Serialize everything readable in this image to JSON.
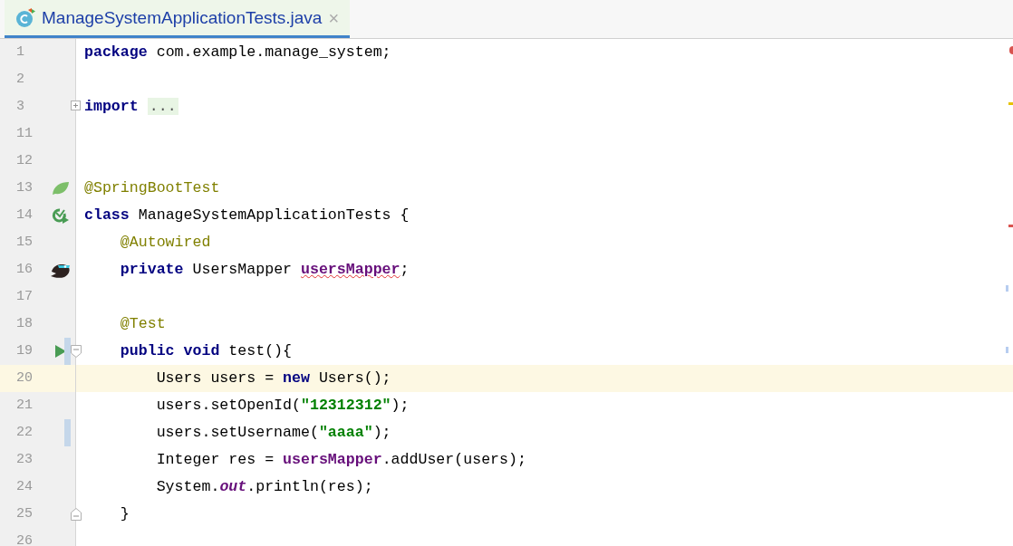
{
  "tab": {
    "title": "ManageSystemApplicationTests.java",
    "close": "×",
    "selected": true
  },
  "lines": [
    {
      "number": "1",
      "tokens": [
        {
          "kind": "keyword",
          "text": "package"
        },
        {
          "kind": "plain",
          "text": " com.example.manage_system;"
        }
      ]
    },
    {
      "number": "2"
    },
    {
      "number": "3",
      "fold": {
        "kind": "collapsed"
      },
      "tokens": [
        {
          "kind": "keyword",
          "text": "import "
        },
        {
          "kind": "folded",
          "text": "..."
        }
      ]
    },
    {
      "number": "11"
    },
    {
      "number": "12"
    },
    {
      "number": "13",
      "kind": "leaf",
      "tokens": [
        {
          "kind": "annotation",
          "text": "@SpringBootTest"
        }
      ]
    },
    {
      "number": "14",
      "kind": "run-class",
      "tokens": [
        {
          "kind": "keyword",
          "text": "class"
        },
        {
          "kind": "plain",
          "text": " ManageSystemApplicationTests {"
        }
      ]
    },
    {
      "number": "15",
      "tokens": [
        {
          "kind": "annotation",
          "text": "    @Autowired"
        }
      ]
    },
    {
      "number": "16",
      "kind": "bird",
      "tokens": [
        {
          "kind": "keyword",
          "text": "    private"
        },
        {
          "kind": "plain",
          "text": " UsersMapper "
        },
        {
          "kind": "field",
          "text": "usersMapper",
          "typo": true
        },
        {
          "kind": "plain",
          "text": ";"
        }
      ]
    },
    {
      "number": "17"
    },
    {
      "number": "18",
      "tokens": [
        {
          "kind": "annotation",
          "text": "    @Test"
        }
      ]
    },
    {
      "number": "19",
      "kind": "run",
      "fold": {
        "kind": "start"
      },
      "changed": true,
      "tokens": [
        {
          "kind": "keyword",
          "text": "    public void"
        },
        {
          "kind": "plain",
          "text": " test(){"
        }
      ]
    },
    {
      "number": "20",
      "current": true,
      "tokens": [
        {
          "kind": "plain",
          "text": "        Users users = "
        },
        {
          "kind": "keyword",
          "text": "new"
        },
        {
          "kind": "plain",
          "text": " Users();"
        }
      ]
    },
    {
      "number": "21",
      "tokens": [
        {
          "kind": "plain",
          "text": "        users.setOpenId("
        },
        {
          "kind": "string",
          "text": "\"12312312\""
        },
        {
          "kind": "plain",
          "text": ");"
        }
      ]
    },
    {
      "number": "22",
      "changed": true,
      "tokens": [
        {
          "kind": "plain",
          "text": "        users.setUsername("
        },
        {
          "kind": "string",
          "text": "\"aaaa\""
        },
        {
          "kind": "plain",
          "text": ");"
        }
      ]
    },
    {
      "number": "23",
      "tokens": [
        {
          "kind": "plain",
          "text": "        Integer res = "
        },
        {
          "kind": "field",
          "text": "usersMapper"
        },
        {
          "kind": "plain",
          "text": ".addUser(users);"
        }
      ]
    },
    {
      "number": "24",
      "tokens": [
        {
          "kind": "plain",
          "text": "        System."
        },
        {
          "kind": "static",
          "text": "out"
        },
        {
          "kind": "plain",
          "text": ".println(res);"
        }
      ]
    },
    {
      "number": "25",
      "fold": {
        "kind": "end"
      },
      "tokens": [
        {
          "kind": "plain",
          "text": "    }"
        }
      ]
    },
    {
      "number": "26"
    }
  ]
}
